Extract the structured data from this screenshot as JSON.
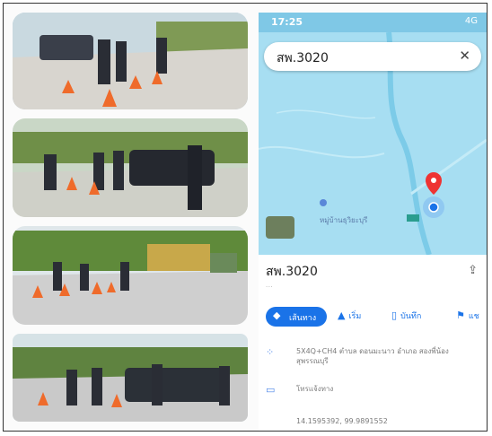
{
  "phone": {
    "status_time": "17:25",
    "status_signal": "4G",
    "search_query": "สพ.3020",
    "close_label": "✕",
    "map_label": "หมู่บ้านธุวิยะบุรี"
  },
  "place": {
    "title": "สพ.3020",
    "subtitle": "...",
    "actions": {
      "directions_label": "เส้นทาง",
      "start_label": "เริ่ม",
      "save_label": "บันทึก",
      "share_partial_label": "แช"
    },
    "address_text": "5X4Q+CH4 ตำบล ดอนมะนาว อำเภอ สองพี่น้อง สุพรรณบุรี",
    "phone_row_text": "โทรแจ้งทาง",
    "coords_text": "14.1595392, 99.9891552"
  },
  "colors": {
    "primary": "#1a73e8",
    "map_water": "#8fd6ef",
    "map_land": "#a7def2",
    "status_bar": "#7fc8e6"
  },
  "icons": {
    "pin": "map-pin-icon",
    "directions": "directions-icon",
    "start": "navigation-arrow-icon",
    "save": "bookmark-icon",
    "share": "share-icon",
    "close": "close-icon",
    "location": "location-dots-icon",
    "keyboard": "keyboard-icon"
  }
}
